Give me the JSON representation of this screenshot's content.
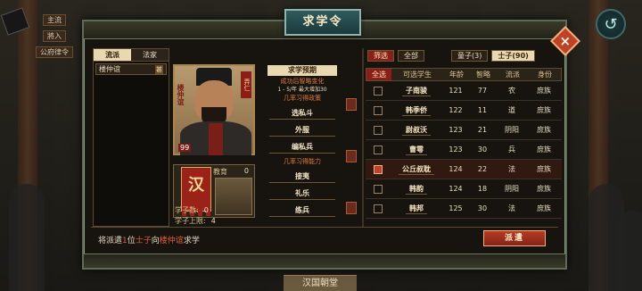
{
  "background": {
    "tags": [
      "主流",
      "將入",
      "公府律令"
    ],
    "bottom_label": "汉国朝堂",
    "back_icon": "↺"
  },
  "dialog": {
    "title": "求学令",
    "close_label": "×"
  },
  "school_panel": {
    "tabs": [
      "流派",
      "法家"
    ],
    "active_tab": 0,
    "items": [
      {
        "name": "楼仲谊",
        "tag": "甚"
      }
    ]
  },
  "portrait": {
    "name": "楼仲谊",
    "seal": "弄仁",
    "level": "99"
  },
  "education": {
    "label": "教育",
    "value": "0",
    "banner": "汉"
  },
  "stats": {
    "student_count_label": "学子数:",
    "student_count": "0",
    "student_limit_label": "学子上限:",
    "student_limit": "4"
  },
  "skills": {
    "expect_header": "求学预期",
    "change_note": "成功后智略变化",
    "change_range": "1 - 5/年 最大增加30",
    "policy_note": "几率习得政策",
    "policies": [
      "选私斗",
      "外服",
      "编私兵"
    ],
    "ability_note": "几率习得能力",
    "abilities": [
      "接夷",
      "礼乐",
      "练兵"
    ]
  },
  "filters": {
    "filter_label": "筛选",
    "all_label": "全部",
    "boy_label": "童子(3)",
    "scholar_label": "士子(90)"
  },
  "table": {
    "headers": [
      "全选",
      "可选学生",
      "年龄",
      "智略",
      "流派",
      "身份"
    ],
    "rows": [
      {
        "name": "子南骏",
        "age": "121",
        "wisdom": "77",
        "school": "农",
        "identity": "庶族",
        "checked": false
      },
      {
        "name": "韩季侨",
        "age": "122",
        "wisdom": "11",
        "school": "道",
        "identity": "庶族",
        "checked": false
      },
      {
        "name": "尉叔沃",
        "age": "123",
        "wisdom": "21",
        "school": "阴阳",
        "identity": "庶族",
        "checked": false
      },
      {
        "name": "曹雩",
        "age": "123",
        "wisdom": "30",
        "school": "兵",
        "identity": "庶族",
        "checked": false
      },
      {
        "name": "公丘叔耽",
        "age": "124",
        "wisdom": "22",
        "school": "法",
        "identity": "庶族",
        "checked": true
      },
      {
        "name": "韩韵",
        "age": "124",
        "wisdom": "18",
        "school": "阴阳",
        "identity": "庶族",
        "checked": false
      },
      {
        "name": "韩邦",
        "age": "125",
        "wisdom": "30",
        "school": "法",
        "identity": "庶族",
        "checked": false
      }
    ]
  },
  "footer": {
    "msg_prefix": "将派遣",
    "msg_count": "1",
    "msg_mid": "位",
    "msg_role": "士子",
    "msg_to": "向",
    "msg_target": "楼仲谊",
    "msg_suffix": "求学",
    "dispatch_label": "派遣"
  },
  "colors": {
    "accent_red": "#c0412a",
    "title_teal": "#2f5a5d",
    "highlight_text": "#e35a3a"
  }
}
